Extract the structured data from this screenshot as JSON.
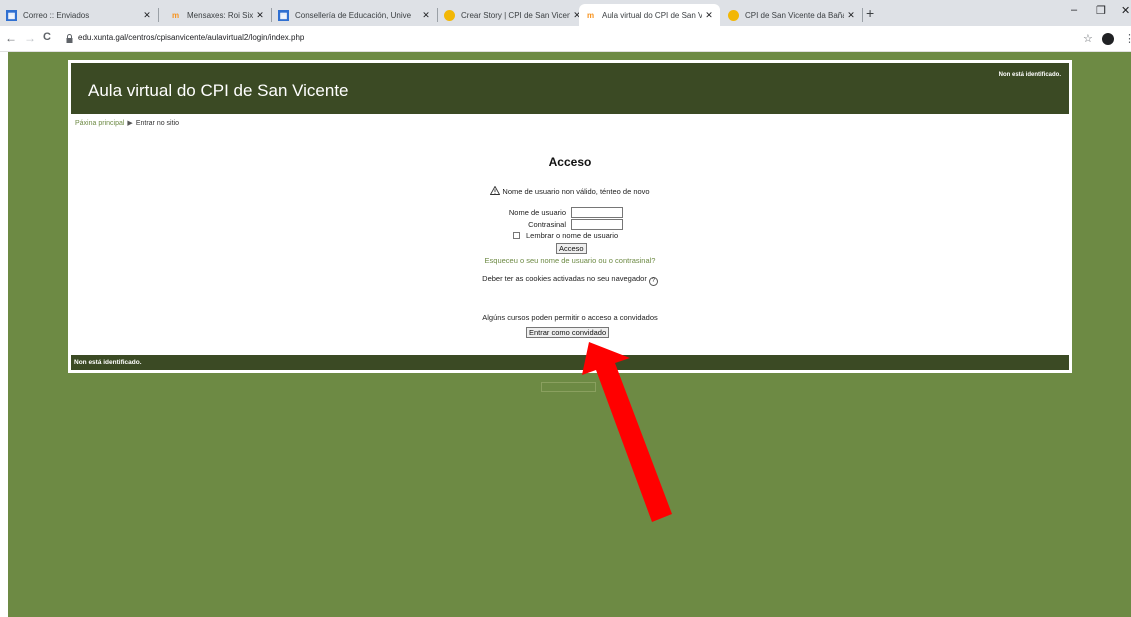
{
  "browser": {
    "tabs": [
      {
        "title": "Correo :: Enviados",
        "icon": "mail-favicon-icon",
        "active": false
      },
      {
        "title": "Mensaxes: Roi Sixto",
        "icon": "moodle-favicon-icon",
        "active": false
      },
      {
        "title": "Consellería de Educación, Unive",
        "icon": "xunta-favicon-icon",
        "active": false
      },
      {
        "title": "Crear Story | CPI de San Vicente",
        "icon": "globe-favicon-icon",
        "active": false
      },
      {
        "title": "Aula virtual do CPI de San Vicen",
        "icon": "moodle-favicon-icon",
        "active": true
      },
      {
        "title": "CPI de San Vicente da Baña",
        "icon": "globe-favicon-icon",
        "active": false
      }
    ],
    "new_tab": "+",
    "url": "edu.xunta.gal/centros/cpisanvicente/aulavirtual2/login/index.php",
    "back": "←",
    "forward": "→",
    "reload": "C",
    "bookmark": "☆",
    "menu": "⋮",
    "minimize": "–",
    "restore": "❐",
    "close": "✕"
  },
  "header": {
    "site_name": "Aula virtual do CPI de San Vicente",
    "login_info": "Non está identificado."
  },
  "breadcrumb": {
    "home": "Páxina principal",
    "separator": "▶",
    "current": "Entrar no sitio"
  },
  "login": {
    "heading": "Acceso",
    "error": "Nome de usuario non válido, ténteo de novo",
    "username_label": "Nome de usuario",
    "username_value": "",
    "password_label": "Contrasinal",
    "password_value": "",
    "remember_label": "Lembrar o nome de usuario",
    "remember_checked": false,
    "submit_label": "Acceso",
    "forgot_link": "Esqueceu o seu nome de usuario ou o contrasinal?",
    "cookies_text": "Deber ter as cookies activadas no seu navegador",
    "guest_text": "Algúns cursos poden permitir o acceso a convidados",
    "guest_button": "Entrar como convidado"
  },
  "footer": {
    "login_info": "Non está identificado."
  },
  "colors": {
    "page_background": "#6d8a44",
    "header_background": "#3b4a24",
    "link": "#6d8a44",
    "annotation_arrow": "#ff0000"
  }
}
